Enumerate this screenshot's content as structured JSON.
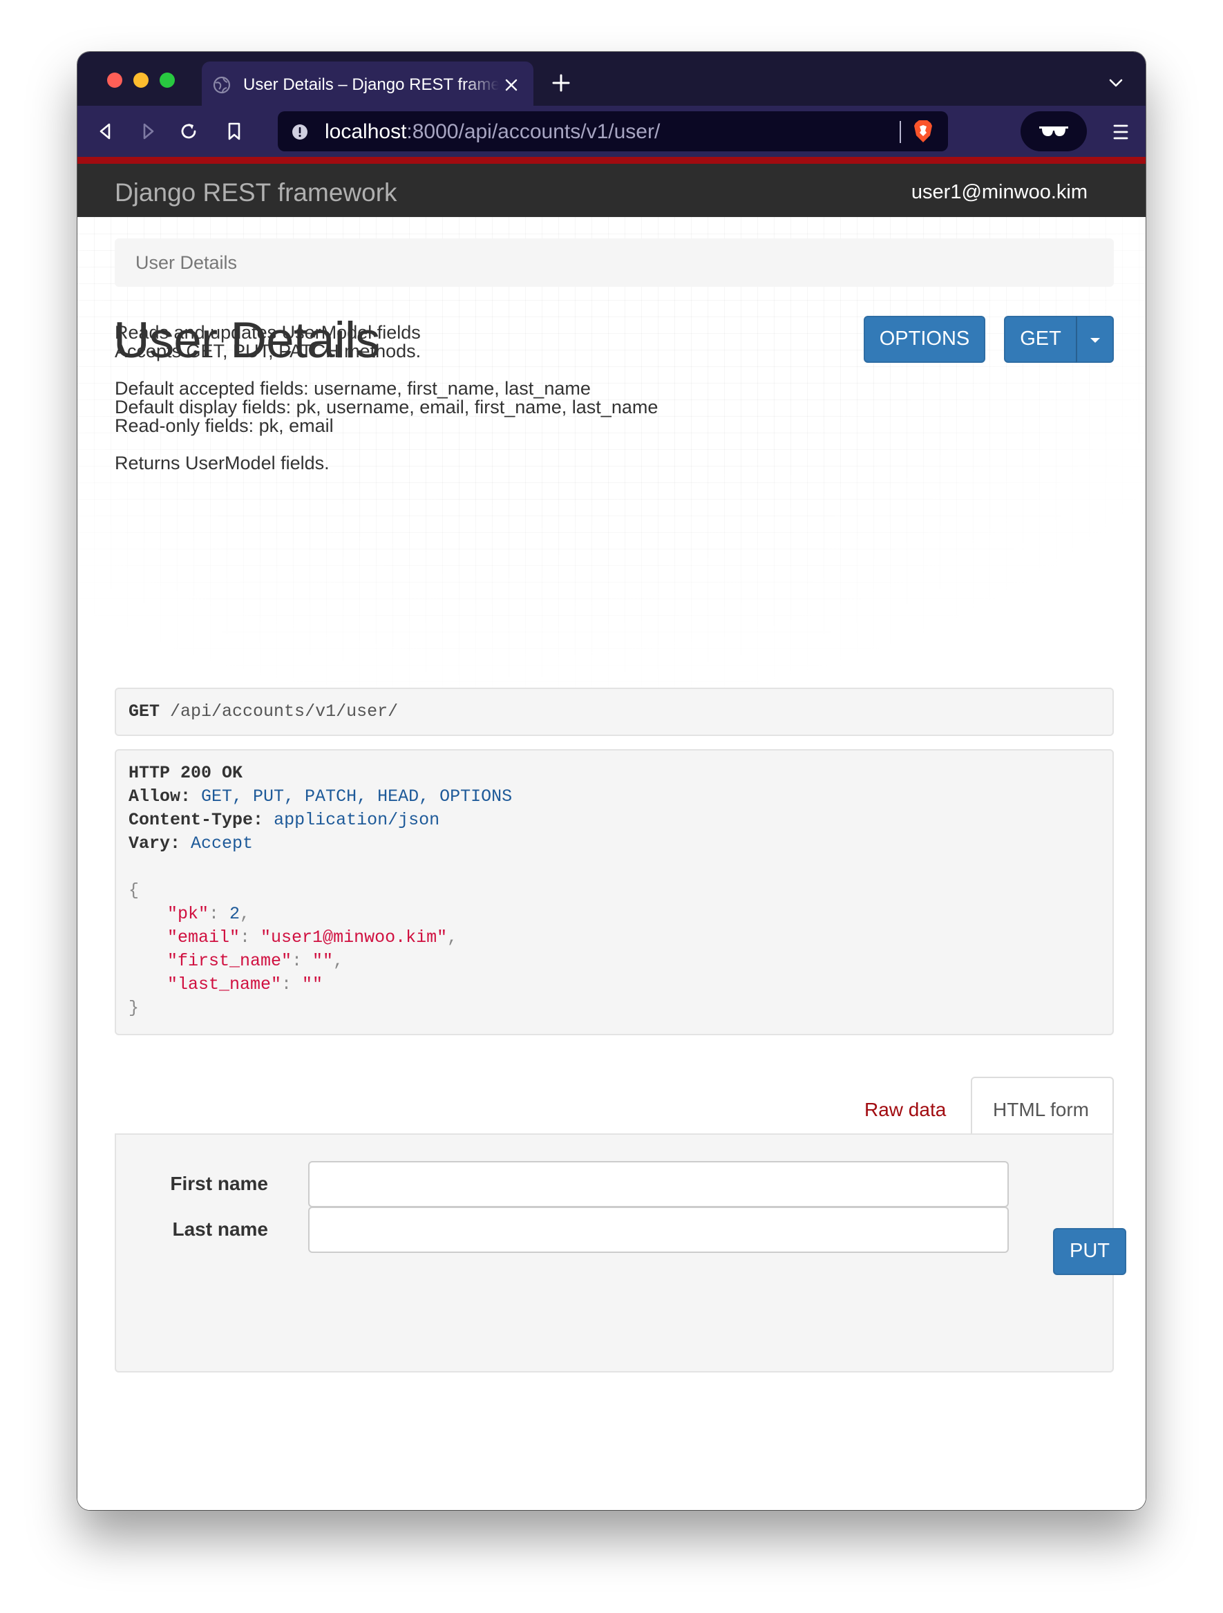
{
  "browser": {
    "tab_title": "User Details – Django REST framework",
    "url_host": "localhost",
    "url_path": ":8000/api/accounts/v1/user/"
  },
  "navbar": {
    "brand": "Django REST framework",
    "user": "user1@minwoo.kim"
  },
  "breadcrumb": {
    "current": "User Details"
  },
  "page": {
    "title": "User Details",
    "options_button": "OPTIONS",
    "get_button": "GET",
    "description": [
      "Reads and updates UserModel fields",
      "Accepts GET, PUT, PATCH methods.",
      "Default accepted fields: username, first_name, last_name",
      "Default display fields: pk, username, email, first_name, last_name",
      "Read-only fields: pk, email",
      "Returns UserModel fields."
    ]
  },
  "request": {
    "method": "GET",
    "path": "/api/accounts/v1/user/"
  },
  "response": {
    "status": "HTTP 200 OK",
    "headers": [
      {
        "key": "Allow:",
        "value": "GET, PUT, PATCH, HEAD, OPTIONS"
      },
      {
        "key": "Content-Type:",
        "value": "application/json"
      },
      {
        "key": "Vary:",
        "value": "Accept"
      }
    ],
    "body": {
      "open": "{",
      "close": "}",
      "fields": [
        {
          "key": "\"pk\"",
          "value": "2",
          "type": "number",
          "comma": ","
        },
        {
          "key": "\"email\"",
          "value": "\"user1@minwoo.kim\"",
          "type": "string",
          "comma": ","
        },
        {
          "key": "\"first_name\"",
          "value": "\"\"",
          "type": "string",
          "comma": ","
        },
        {
          "key": "\"last_name\"",
          "value": "\"\"",
          "type": "string",
          "comma": ""
        }
      ]
    }
  },
  "form": {
    "tabs": {
      "raw": "Raw data",
      "html": "HTML form"
    },
    "fields": [
      {
        "label": "First name",
        "value": ""
      },
      {
        "label": "Last name",
        "value": ""
      }
    ],
    "submit": "PUT"
  },
  "colors": {
    "primary_button": "#337ab7",
    "navbar": "#2d2d2d",
    "accent_red": "#a10b10",
    "browser_chrome": "#2c2558"
  }
}
